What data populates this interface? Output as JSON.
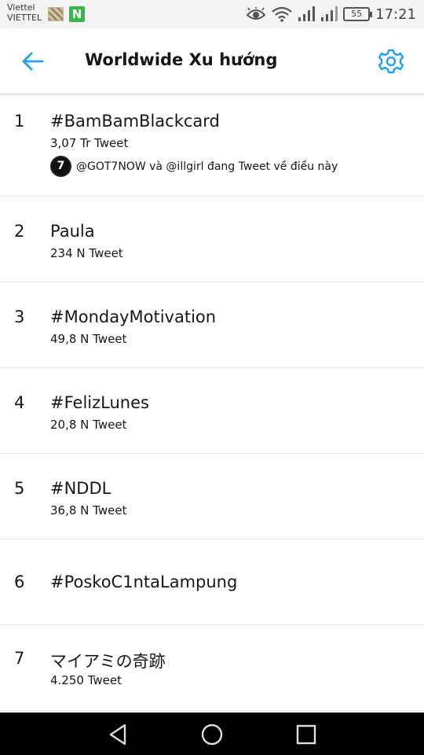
{
  "status_bar": {
    "carrier_line1": "Viettel",
    "carrier_line2": "VIETTEL",
    "notification_letter": "N",
    "battery": "55",
    "time": "17:21"
  },
  "header": {
    "title": "Worldwide Xu hướng",
    "back_icon": "arrow-left-icon",
    "settings_icon": "gear-icon",
    "accent_color": "#1da1f2"
  },
  "trends": [
    {
      "rank": "1",
      "name": "#BamBamBlackcard",
      "count": "3,07 Tr Tweet",
      "context": "@GOT7NOW và @illgirl đang Tweet về điều này",
      "context_avatar_text": "7"
    },
    {
      "rank": "2",
      "name": "Paula",
      "count": "234 N Tweet"
    },
    {
      "rank": "3",
      "name": "#MondayMotivation",
      "count": "49,8 N Tweet"
    },
    {
      "rank": "4",
      "name": "#FelizLunes",
      "count": "20,8 N Tweet"
    },
    {
      "rank": "5",
      "name": "#NDDL",
      "count": "36,8 N Tweet"
    },
    {
      "rank": "6",
      "name": "#PoskoC1ntaLampung",
      "count": ""
    },
    {
      "rank": "7",
      "name": "マイアミの奇跡",
      "count": "4.250 Tweet"
    }
  ],
  "nav_bar": {
    "back_icon": "triangle-back-icon",
    "home_icon": "circle-home-icon",
    "recents_icon": "square-recents-icon"
  }
}
